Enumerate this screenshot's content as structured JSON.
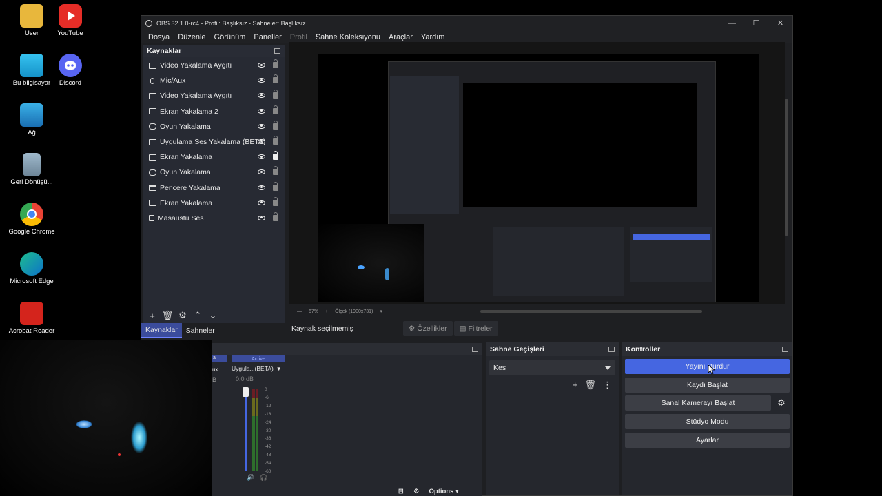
{
  "desktop": {
    "icons": [
      {
        "label": "User"
      },
      {
        "label": "YouTube"
      },
      {
        "label": "Bu bilgisayar"
      },
      {
        "label": "Discord"
      },
      {
        "label": "Ağ"
      },
      {
        "label": "Geri Dönüşü..."
      },
      {
        "label": "Google Chrome"
      },
      {
        "label": "Microsoft Edge"
      },
      {
        "label": "Acrobat Reader"
      }
    ]
  },
  "window": {
    "title": "OBS 32.1.0-rc4 - Profil: Başlıksız - Sahneler: Başlıksız",
    "menu": [
      "Dosya",
      "Düzenle",
      "Görünüm",
      "Paneller",
      "Profil",
      "Sahne Koleksiyonu",
      "Araçlar",
      "Yardım"
    ]
  },
  "sources": {
    "title": "Kaynaklar",
    "items": [
      {
        "name": "Video Yakalama Aygıtı",
        "icon": "camera-icon",
        "locked": false
      },
      {
        "name": "Mic/Aux",
        "icon": "microphone-icon",
        "locked": false
      },
      {
        "name": "Video Yakalama Aygıtı",
        "icon": "camera-icon",
        "locked": false
      },
      {
        "name": "Ekran Yakalama 2",
        "icon": "monitor-icon",
        "locked": false
      },
      {
        "name": "Oyun Yakalama",
        "icon": "gamepad-icon",
        "locked": false
      },
      {
        "name": "Uygulama Ses Yakalama (BETA)",
        "icon": "app-audio-icon",
        "locked": false
      },
      {
        "name": "Ekran Yakalama",
        "icon": "monitor-icon",
        "locked": true
      },
      {
        "name": "Oyun Yakalama",
        "icon": "gamepad-icon",
        "locked": false
      },
      {
        "name": "Pencere Yakalama",
        "icon": "window-icon",
        "locked": false
      },
      {
        "name": "Ekran Yakalama",
        "icon": "monitor-icon",
        "locked": false
      },
      {
        "name": "Masaüstü Ses",
        "icon": "speaker-icon",
        "locked": false
      }
    ]
  },
  "tabs": {
    "sources": "Kaynaklar",
    "scenes": "Sahneler"
  },
  "context": {
    "no_selection": "Kaynak seçilmemiş",
    "properties": "Özellikler",
    "filters": "Filtreler"
  },
  "zoom": {
    "level": "67%",
    "scale": "Ölçek (1900x731)"
  },
  "mixer": {
    "active_label": "Active",
    "channel_name": "Uygula...(BETA)",
    "db_value": "0.0 dB",
    "left_fragment": "al",
    "left_fragment2": "ux",
    "left_fragment3": "B",
    "scale": [
      "0",
      "-6",
      "-12",
      "-18",
      "-24",
      "-30",
      "-36",
      "-42",
      "-48",
      "-54",
      "-60"
    ],
    "options_label": "Options"
  },
  "transitions": {
    "title": "Sahne Geçişleri",
    "selected": "Kes"
  },
  "controls": {
    "title": "Kontroller",
    "stop_stream": "Yayını Durdur",
    "start_recording": "Kaydı Başlat",
    "start_virtual_cam": "Sanal Kamerayı Başlat",
    "studio_mode": "Stüdyo Modu",
    "settings": "Ayarlar"
  },
  "colors": {
    "accent": "#4566e1",
    "tab_active": "#3b4c9c",
    "panel": "#272a33",
    "bg": "#1e1f22"
  }
}
